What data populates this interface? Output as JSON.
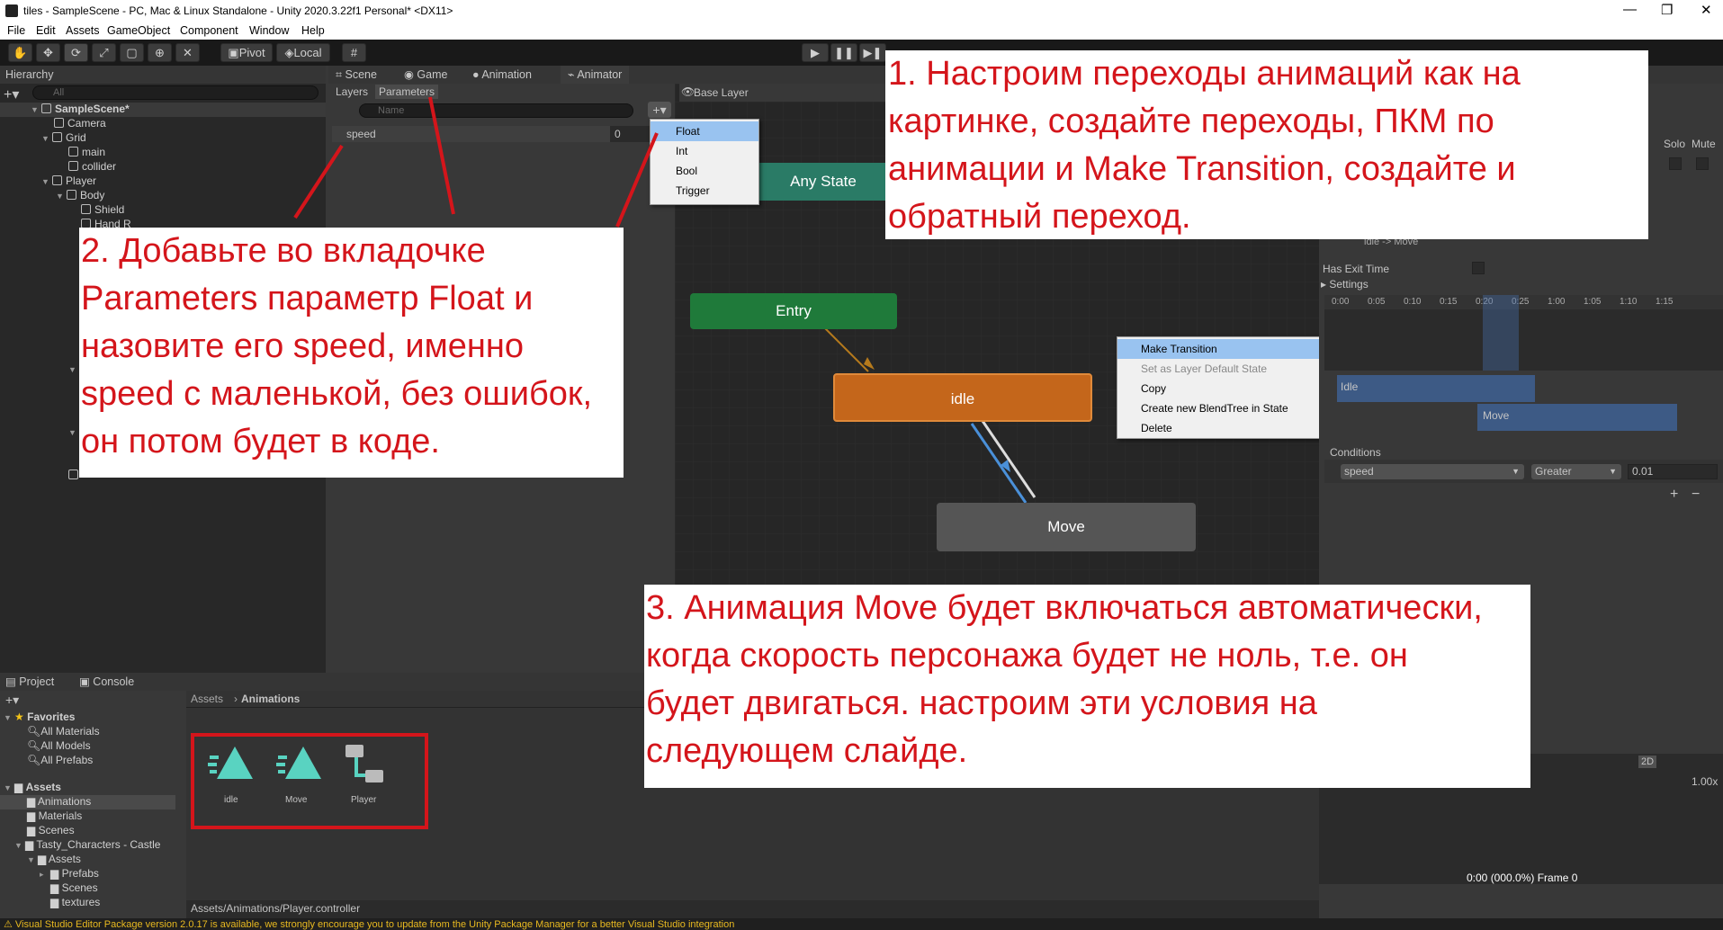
{
  "window": {
    "title": "tiles - SampleScene - PC, Mac & Linux Standalone - Unity 2020.3.22f1 Personal* <DX11>"
  },
  "menu": [
    "File",
    "Edit",
    "Assets",
    "GameObject",
    "Component",
    "Window",
    "Help"
  ],
  "toolbar": {
    "pivot": "Pivot",
    "local": "Local"
  },
  "hierarchy": {
    "tab": "Hierarchy",
    "search_placeholder": "All",
    "items": [
      "SampleScene*",
      "Camera",
      "Grid",
      "main",
      "collider",
      "Player",
      "Body",
      "Shield",
      "Hand R"
    ]
  },
  "center_tabs": [
    "Scene",
    "Game",
    "Animation",
    "Animator"
  ],
  "animator": {
    "layers_tab": "Layers",
    "parameters_tab": "Parameters",
    "name_placeholder": "Name",
    "param_name": "speed",
    "param_value": "0",
    "breadcrumb": "Base Layer",
    "add_menu": [
      "Float",
      "Int",
      "Bool",
      "Trigger"
    ],
    "states": {
      "any": "Any State",
      "entry": "Entry",
      "idle": "idle",
      "move": "Move"
    },
    "context_menu": [
      "Make Transition",
      "Set as Layer Default State",
      "Copy",
      "Create new BlendTree in State",
      "Delete"
    ]
  },
  "inspector": {
    "solo": "Solo",
    "mute": "Mute",
    "transition": "idle -> Move",
    "has_exit_time": "Has Exit Time",
    "settings": "Settings",
    "timeline": [
      "0:00",
      "0:05",
      "0:10",
      "0:15",
      "0:20",
      "0:25",
      "1:00",
      "1:05",
      "1:10",
      "1:15"
    ],
    "clip_idle": "Idle",
    "clip_move": "Move",
    "conditions": "Conditions",
    "cond_param": "speed",
    "cond_op": "Greater",
    "cond_value": "0.01"
  },
  "preview": {
    "mode": "2D",
    "speed": "1.00x",
    "frame": "0:00 (000.0%) Frame 0"
  },
  "project": {
    "tabs": [
      "Project",
      "Console"
    ],
    "favorites": "Favorites",
    "fav_items": [
      "All Materials",
      "All Models",
      "All Prefabs"
    ],
    "assets": "Assets",
    "asset_folders": [
      "Animations",
      "Materials",
      "Scenes",
      "Tasty_Characters - Castle",
      "Assets",
      "Prefabs",
      "Scenes",
      "textures"
    ],
    "breadcrumb_root": "Assets",
    "breadcrumb_current": "Animations",
    "files": [
      "idle",
      "Move",
      "Player"
    ],
    "path": "Assets/Animations/Player.controller"
  },
  "status": "Visual Studio Editor Package version 2.0.17 is available, we strongly encourage you to update from the Unity Package Manager for a better Visual Studio integration",
  "notes": {
    "n1": [
      "1. Настроим переходы анимаций как на",
      "картинке, создайте переходы, ПКМ по",
      "анимации и Make Transition, создайте и",
      "обратный переход."
    ],
    "n2": [
      "2. Добавьте во вкладочке",
      "Parameters параметр Float и",
      "назовите его speed, именно",
      "speed с маленькой, без ошибок,",
      "он потом будет в коде."
    ],
    "n3": [
      "3. Анимация Move будет включаться автоматически,",
      "когда скорость персонажа будет не ноль, т.е. он",
      "будет двигаться. настроим эти условия на",
      "следующем слайде."
    ]
  },
  "colors": {
    "annotation": "#d4151b",
    "entry": "#1f7a3a",
    "idle": "#c4661b",
    "any": "#2a7b66"
  }
}
